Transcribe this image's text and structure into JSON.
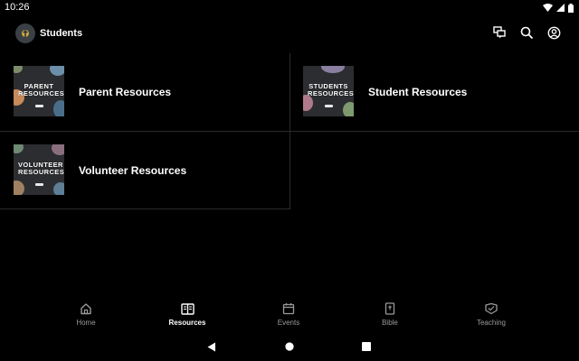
{
  "status_bar": {
    "time": "10:26"
  },
  "app_bar": {
    "title": "Students"
  },
  "tiles": [
    {
      "label": "Parent Resources",
      "thumb_text": "PARENT RESOURCES"
    },
    {
      "label": "Student Resources",
      "thumb_text": "STUDENTS RESOURCES"
    },
    {
      "label": "Volunteer Resources",
      "thumb_text": "VOLUNTEER RESOURCES"
    }
  ],
  "bottom_nav": {
    "items": [
      {
        "label": "Home",
        "icon": "home-icon"
      },
      {
        "label": "Resources",
        "icon": "resources-icon",
        "active": true
      },
      {
        "label": "Events",
        "icon": "calendar-icon"
      },
      {
        "label": "Bible",
        "icon": "bible-icon"
      },
      {
        "label": "Teaching",
        "icon": "teaching-icon"
      }
    ]
  },
  "colors": {
    "background": "#000000",
    "text": "#ffffff",
    "inactive_nav": "#9a9a9a",
    "divider": "#2a2a2a"
  }
}
